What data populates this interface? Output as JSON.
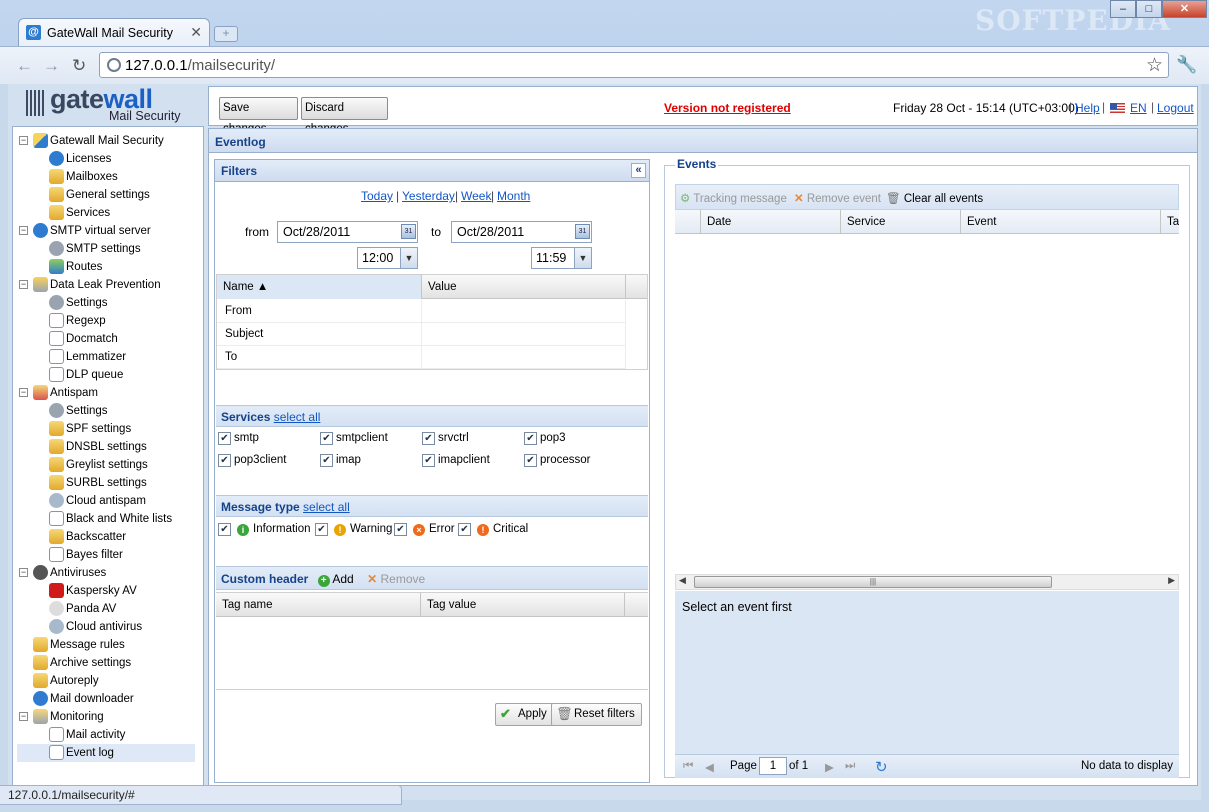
{
  "browser": {
    "tab_title": "GateWall Mail Security",
    "tab_favicon": "@",
    "tab_close": "✕",
    "new_tab_icon": "+",
    "url_host": "127.0.0.1",
    "url_path": "/mailsecurity/",
    "status_text": "127.0.0.1/mailsecurity/#",
    "watermark": "SOFTPEDIA",
    "window": {
      "minimize": "–",
      "maximize": "□",
      "close": "✕"
    }
  },
  "app": {
    "logo": {
      "word_a": "gate",
      "word_b": "wall",
      "sub": "Mail Security"
    },
    "topbar": {
      "save": "Save changes",
      "discard": "Discard changes",
      "version": "Version not registered",
      "clock": "Friday 28 Oct - 15:14 (UTC+03:00)",
      "help": "Help",
      "lang": "EN",
      "logout": "Logout"
    },
    "tree": [
      {
        "label": "Gatewall Mail Security",
        "level": 0,
        "expander": "−",
        "icon": "gw"
      },
      {
        "label": "Licenses",
        "level": 1,
        "icon": "info"
      },
      {
        "label": "Mailboxes",
        "level": 1,
        "icon": "mail"
      },
      {
        "label": "General settings",
        "level": 1,
        "icon": "mail"
      },
      {
        "label": "Services",
        "level": 1,
        "icon": "mail"
      },
      {
        "label": "SMTP virtual server",
        "level": 0,
        "expander": "−",
        "icon": "at"
      },
      {
        "label": "SMTP settings",
        "level": 1,
        "icon": "gear"
      },
      {
        "label": "Routes",
        "level": 1,
        "icon": "route"
      },
      {
        "label": "Data Leak Prevention",
        "level": 0,
        "expander": "−",
        "icon": "dlp"
      },
      {
        "label": "Settings",
        "level": 1,
        "icon": "gear"
      },
      {
        "label": "Regexp",
        "level": 1,
        "icon": "doc"
      },
      {
        "label": "Docmatch",
        "level": 1,
        "icon": "doc"
      },
      {
        "label": "Lemmatizer",
        "level": 1,
        "icon": "doc"
      },
      {
        "label": "DLP queue",
        "level": 1,
        "icon": "doc"
      },
      {
        "label": "Antispam",
        "level": 0,
        "expander": "−",
        "icon": "spam"
      },
      {
        "label": "Settings",
        "level": 1,
        "icon": "gear"
      },
      {
        "label": "SPF settings",
        "level": 1,
        "icon": "mail"
      },
      {
        "label": "DNSBL settings",
        "level": 1,
        "icon": "mail"
      },
      {
        "label": "Greylist settings",
        "level": 1,
        "icon": "mail"
      },
      {
        "label": "SURBL settings",
        "level": 1,
        "icon": "mail"
      },
      {
        "label": "Cloud antispam",
        "level": 1,
        "icon": "cloud"
      },
      {
        "label": "Black and White lists",
        "level": 1,
        "icon": "doc"
      },
      {
        "label": "Backscatter",
        "level": 1,
        "icon": "mail"
      },
      {
        "label": "Bayes filter",
        "level": 1,
        "icon": "doc"
      },
      {
        "label": "Antiviruses",
        "level": 0,
        "expander": "−",
        "icon": "virus"
      },
      {
        "label": "Kaspersky AV",
        "level": 1,
        "icon": "k"
      },
      {
        "label": "Panda AV",
        "level": 1,
        "icon": "panda"
      },
      {
        "label": "Cloud antivirus",
        "level": 1,
        "icon": "cloud"
      },
      {
        "label": "Message rules",
        "level": 0,
        "icon": "mail"
      },
      {
        "label": "Archive settings",
        "level": 0,
        "icon": "mail"
      },
      {
        "label": "Autoreply",
        "level": 0,
        "icon": "mail"
      },
      {
        "label": "Mail downloader",
        "level": 0,
        "icon": "at"
      },
      {
        "label": "Monitoring",
        "level": 0,
        "expander": "−",
        "icon": "mon"
      },
      {
        "label": "Mail activity",
        "level": 1,
        "icon": "doc"
      },
      {
        "label": "Event log",
        "level": 1,
        "icon": "doc",
        "selected": true
      }
    ],
    "eventlog_title": "Eventlog",
    "filters": {
      "title": "Filters",
      "collapse_icon": "«",
      "quick": [
        "Today",
        "Yesterday",
        "Week",
        "Month"
      ],
      "from_label": "from",
      "to_label": "to",
      "from_date": "Oct/28/2011",
      "to_date": "Oct/28/2011",
      "from_time": "12:00",
      "to_time": "11:59",
      "cal_glyph": "31",
      "grid_cols": [
        "Name ▲",
        "Value"
      ],
      "grid_rows": [
        "From",
        "Subject",
        "To"
      ],
      "services_title": "Services",
      "services_select_all": "select all",
      "services": [
        "smtp",
        "smtpclient",
        "srvctrl",
        "pop3",
        "pop3client",
        "imap",
        "imapclient",
        "processor"
      ],
      "msgtype_title": "Message type",
      "msgtype_select_all": "select all",
      "msgtypes": [
        {
          "label": "Information",
          "glyph": "i",
          "color": "#3aa53a"
        },
        {
          "label": "Warning",
          "glyph": "!",
          "color": "#e8a400"
        },
        {
          "label": "Error",
          "glyph": "×",
          "color": "#ef6a1a"
        },
        {
          "label": "Critical",
          "glyph": "!",
          "color": "#ef6a1a"
        }
      ],
      "custom_title": "Custom header",
      "add_label": "Add",
      "remove_label": "Remove",
      "tag_cols": [
        "Tag name",
        "Tag value"
      ],
      "apply_label": "Apply",
      "reset_label": "Reset filters"
    },
    "events": {
      "legend": "Events",
      "tracking": "Tracking message",
      "remove": "Remove event",
      "clear": "Clear all events",
      "cols": [
        "Date",
        "Service",
        "Event",
        "Ta"
      ],
      "detail": "Select an event first",
      "page_label": "Page",
      "page_value": "1",
      "of_label": "of 1",
      "no_data": "No data to display"
    },
    "colors": {
      "header_blue": "#15428b",
      "link": "#1357c5",
      "alert": "#e00000",
      "panel": "#d3e0ef"
    }
  }
}
